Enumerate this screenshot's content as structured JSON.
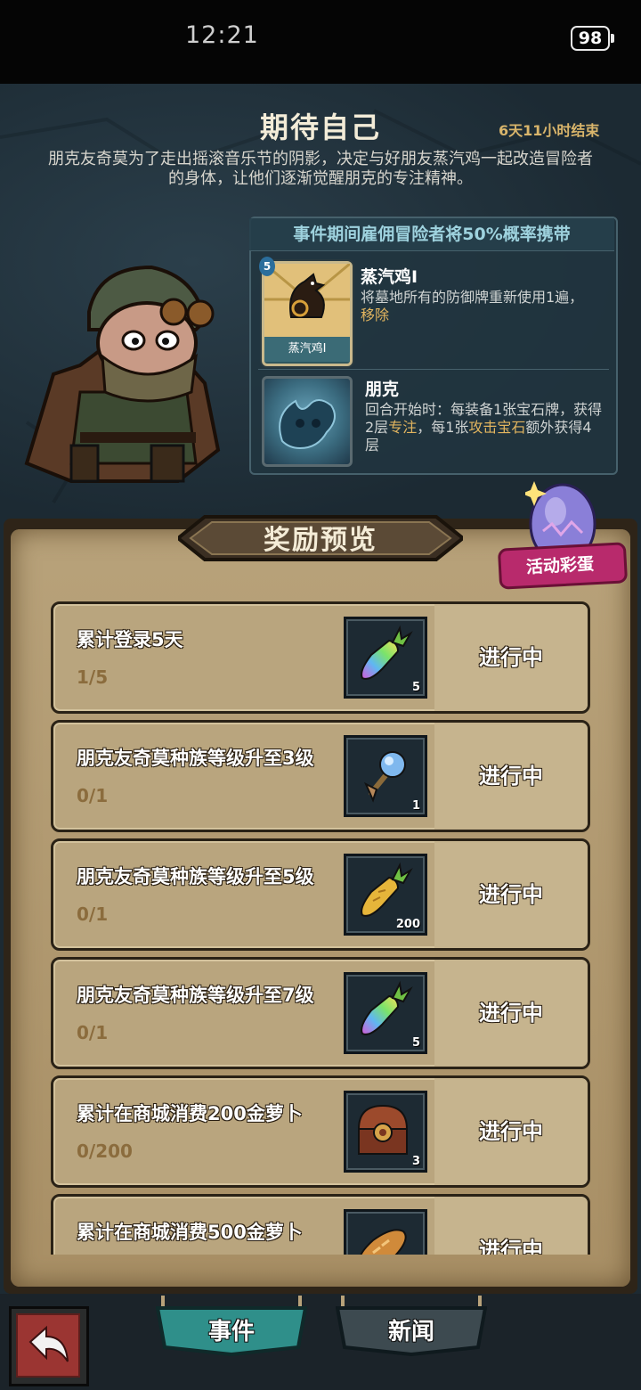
{
  "status_bar": {
    "time": "12:21",
    "battery": "98"
  },
  "event": {
    "title": "期待自己",
    "countdown": "6天11小时结束",
    "description": "朋克友奇莫为了走出摇滚音乐节的阴影，决定与好朋友蒸汽鸡一起改造冒险者的身体，让他们逐渐觉醒朋克的专注精神。",
    "panel_header": "事件期间雇佣冒险者将50%概率携带",
    "card": {
      "cost": "5",
      "card_label": "蒸汽鸡I",
      "name": "蒸汽鸡I",
      "desc": "将墓地所有的防御牌重新使用1遍，",
      "desc_highlight": "移除"
    },
    "trait": {
      "name": "朋克",
      "desc_1": "回合开始时：每装备1张宝石牌，获得2层",
      "highlight_1": "专注",
      "desc_2": "，每1张",
      "highlight_2": "攻击宝石",
      "desc_3": "额外获得4层"
    }
  },
  "rewards": {
    "title": "奖励预览",
    "egg_label": "活动彩蛋",
    "items": [
      {
        "title": "累计登录5天",
        "progress": "1/5",
        "reward_icon": "rainbow-carrot-icon",
        "qty": "5",
        "status": "进行中"
      },
      {
        "title": "朋克友奇莫种族等级升至3级",
        "progress": "0/1",
        "reward_icon": "blue-gem-key-icon",
        "qty": "1",
        "status": "进行中"
      },
      {
        "title": "朋克友奇莫种族等级升至5级",
        "progress": "0/1",
        "reward_icon": "gold-carrot-icon",
        "qty": "200",
        "status": "进行中"
      },
      {
        "title": "朋克友奇莫种族等级升至7级",
        "progress": "0/1",
        "reward_icon": "rainbow-carrot-icon",
        "qty": "5",
        "status": "进行中"
      },
      {
        "title": "累计在商城消费200金萝卜",
        "progress": "0/200",
        "reward_icon": "treasure-chest-icon",
        "qty": "3",
        "status": "进行中"
      },
      {
        "title": "累计在商城消费500金萝卜",
        "progress": "",
        "reward_icon": "bread-icon",
        "qty": "",
        "status": "进行中"
      }
    ]
  },
  "nav": {
    "tab_event": "事件",
    "tab_news": "新闻",
    "back_icon": "back-arrow-icon"
  }
}
